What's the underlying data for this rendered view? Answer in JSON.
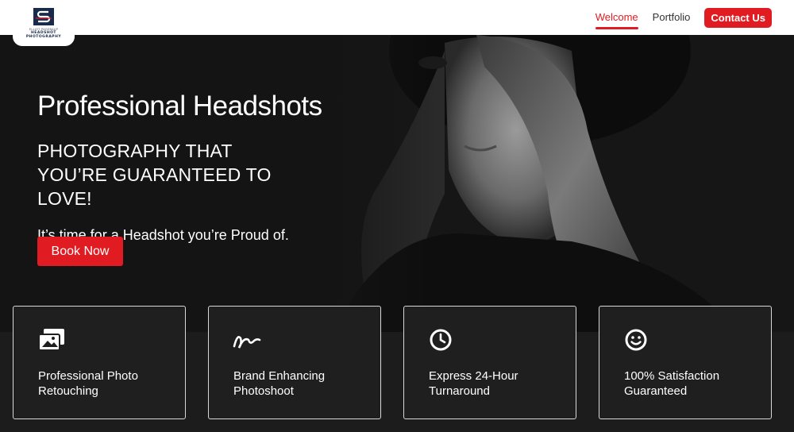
{
  "brand": {
    "small_line": "ELLIOT PAGEBAUP",
    "line1": "HEADSHOT",
    "line2": "PHOTOGRAPHY",
    "accent": "#e01b22",
    "navy": "#1a2a4a"
  },
  "nav": {
    "items": [
      {
        "label": "Welcome",
        "active": true
      },
      {
        "label": "Portfolio",
        "active": false
      }
    ],
    "cta": "Contact Us"
  },
  "hero": {
    "title": "Professional Headshots",
    "subtitle": "PHOTOGRAPHY THAT YOU’RE GUARANTEED TO LOVE!",
    "tagline": "It’s time for a Headshot you’re Proud of.",
    "button": "Book Now"
  },
  "features": [
    {
      "icon": "photos-icon",
      "label": "Professional Photo Retouching"
    },
    {
      "icon": "signature-icon",
      "label": "Brand Enhancing Photoshoot"
    },
    {
      "icon": "clock-icon",
      "label": "Express 24-Hour Turnaround"
    },
    {
      "icon": "smiley-icon",
      "label": "100% Satisfaction Guaranteed"
    }
  ]
}
